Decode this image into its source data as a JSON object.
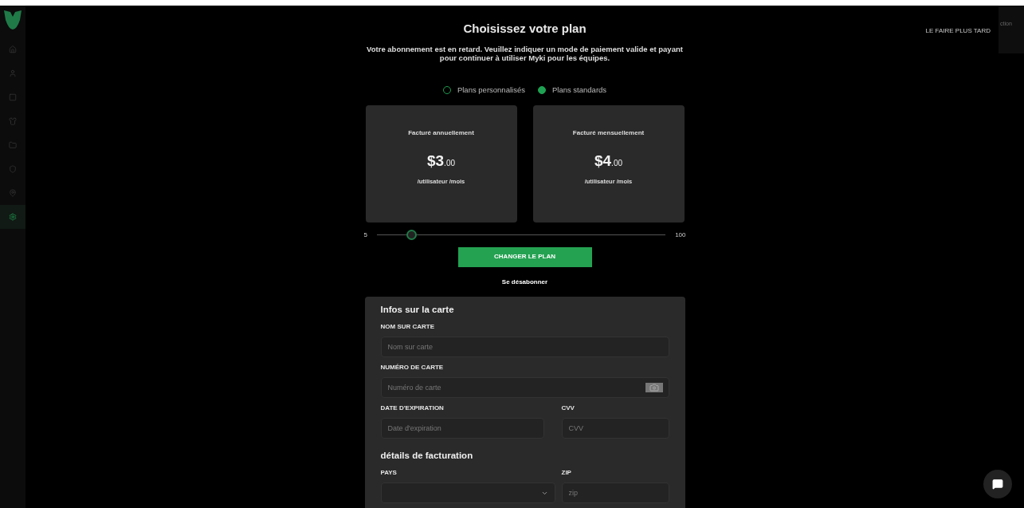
{
  "sidebar": {
    "items": [
      {
        "selected": false
      },
      {
        "selected": false
      },
      {
        "selected": false
      },
      {
        "selected": false
      },
      {
        "selected": false
      },
      {
        "selected": false
      },
      {
        "selected": false
      },
      {
        "selected": true
      }
    ]
  },
  "corner_tab": "ction",
  "later_link": "LE FAIRE PLUS TARD",
  "title": "Choisissez votre plan",
  "subtitle": "Votre abonnement est en retard. Veuillez indiquer un mode de paiement valide et payant pour continuer à utiliser Myki pour les équipes.",
  "plan_types": [
    {
      "label": "Plans personnalisés",
      "selected": false
    },
    {
      "label": "Plans standards",
      "selected": true
    }
  ],
  "plans": [
    {
      "billing": "Facturé annuellement",
      "price": "$3",
      "cents": ".00",
      "unit": "/utilisateur /mois"
    },
    {
      "billing": "Facturé mensuellement",
      "price": "$4",
      "cents": ".00",
      "unit": "/utilisateur /mois"
    }
  ],
  "users_slider": {
    "min": "5",
    "max": "100",
    "level": 0.12
  },
  "change_button": "CHANGER LE PLAN",
  "unsubscribe": "Se désabonner",
  "card_section": {
    "title": "Infos sur la carte",
    "fields": [
      {
        "label": "NOM SUR CARTE",
        "placeholder": "Nom sur carte"
      },
      {
        "label": "NUMÉRO DE CARTE",
        "placeholder": "Numéro de carte"
      }
    ],
    "expiry": {
      "label": "DATE D'EXPIRATION",
      "placeholder": "Date d'expiration"
    },
    "cvv": {
      "label": "CVV",
      "placeholder": "CVV"
    }
  },
  "billing_section": {
    "title": "détails de facturation",
    "country": {
      "label": "PAYS"
    },
    "zip": {
      "label": "ZIP",
      "placeholder": "zip"
    }
  }
}
